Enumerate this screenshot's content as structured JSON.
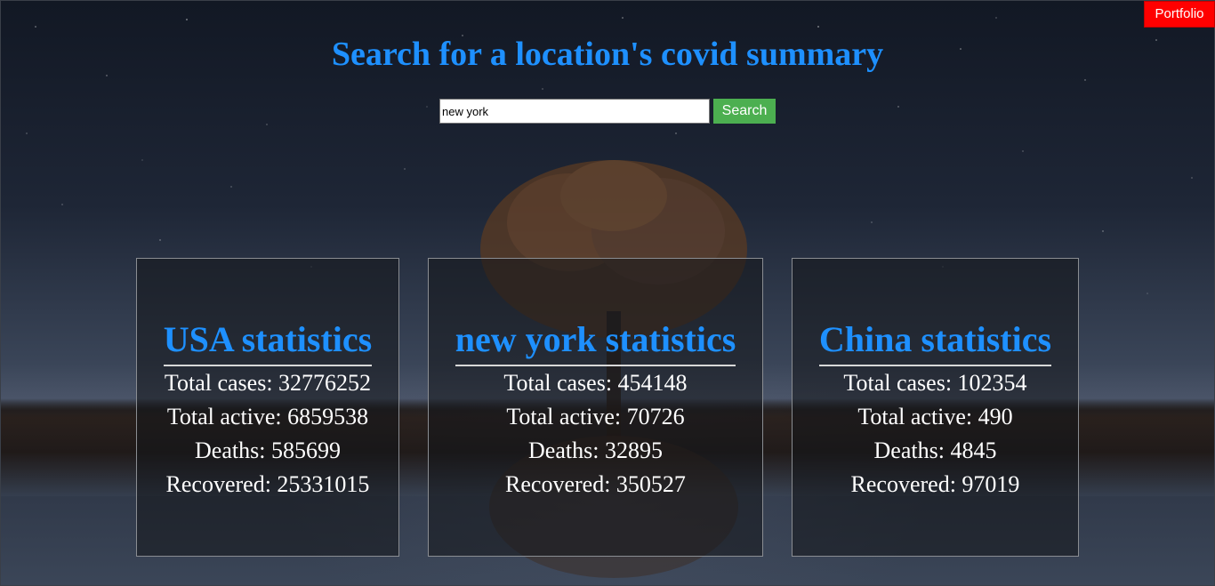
{
  "header": {
    "portfolio_label": "Portfolio",
    "title": "Search for a location's covid summary"
  },
  "search": {
    "value": "new york",
    "button_label": "Search"
  },
  "cards": [
    {
      "heading": "USA statistics",
      "total_cases": "Total cases: 32776252",
      "total_active": "Total active: 6859538",
      "deaths": "Deaths: 585699",
      "recovered": "Recovered: 25331015"
    },
    {
      "heading": "new york statistics",
      "total_cases": "Total cases: 454148",
      "total_active": "Total active: 70726",
      "deaths": "Deaths: 32895",
      "recovered": "Recovered: 350527"
    },
    {
      "heading": "China statistics",
      "total_cases": "Total cases: 102354",
      "total_active": "Total active: 490",
      "deaths": "Deaths: 4845",
      "recovered": "Recovered: 97019"
    }
  ],
  "colors": {
    "accent": "#1e90ff",
    "portfolio_button": "#ff0000",
    "search_button": "#4caf50"
  }
}
